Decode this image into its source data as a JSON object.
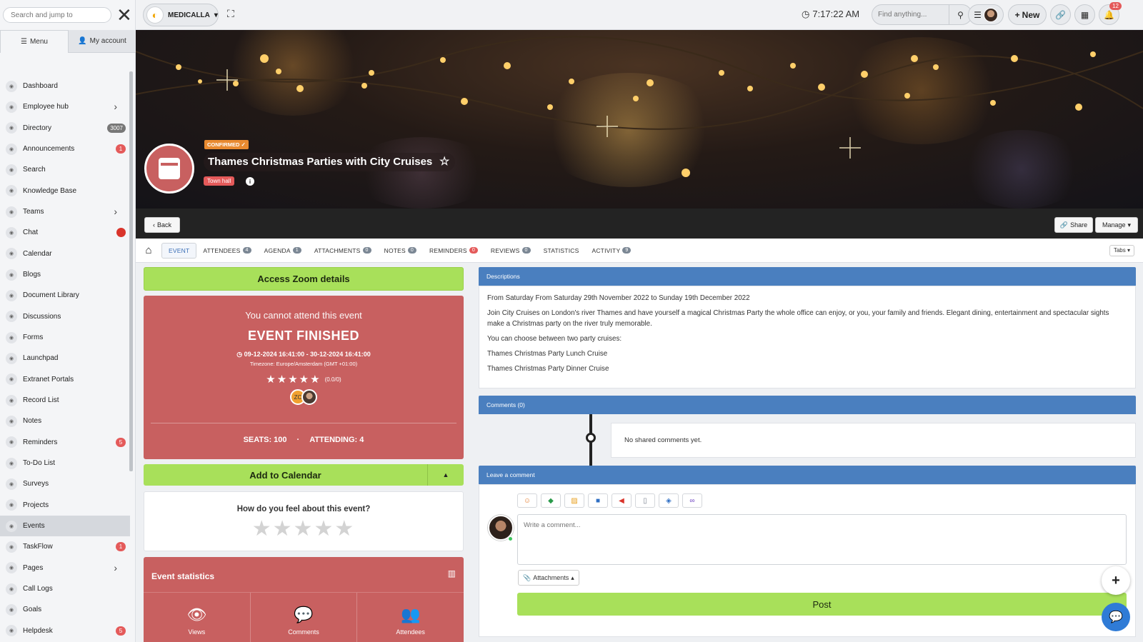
{
  "sidebar": {
    "search_placeholder": "Search and jump to",
    "tabs": [
      {
        "label": "Menu"
      },
      {
        "label": "My account"
      }
    ],
    "items": [
      {
        "label": "Dashboard"
      },
      {
        "label": "Employee hub"
      },
      {
        "label": "Directory",
        "badge": "3007"
      },
      {
        "label": "Announcements",
        "badge": "1"
      },
      {
        "label": "Search"
      },
      {
        "label": "Knowledge Base"
      },
      {
        "label": "Teams"
      },
      {
        "label": "Chat"
      },
      {
        "label": "Calendar"
      },
      {
        "label": "Blogs"
      },
      {
        "label": "Document Library"
      },
      {
        "label": "Discussions"
      },
      {
        "label": "Forms"
      },
      {
        "label": "Launchpad"
      },
      {
        "label": "Extranet Portals"
      },
      {
        "label": "Record List"
      },
      {
        "label": "Notes"
      },
      {
        "label": "Reminders",
        "badge": "5"
      },
      {
        "label": "To-Do List"
      },
      {
        "label": "Surveys"
      },
      {
        "label": "Projects"
      },
      {
        "label": "Events"
      },
      {
        "label": "TaskFlow",
        "badge": "1"
      },
      {
        "label": "Pages"
      },
      {
        "label": "Call Logs"
      },
      {
        "label": "Goals"
      },
      {
        "label": "Helpdesk",
        "badge": "5"
      }
    ]
  },
  "topbar": {
    "brand": "MEDICALLA",
    "time": "7:17:22 AM",
    "find_placeholder": "Find anything...",
    "new_label": "New",
    "notifications": "12"
  },
  "event": {
    "status": "CONFIRMED",
    "title": "Thames Christmas Parties with City Cruises",
    "category": "Town hall",
    "back_label": "Back",
    "share_label": "Share",
    "manage_label": "Manage"
  },
  "tabs": {
    "items": [
      {
        "label": "Event"
      },
      {
        "label": "Attendees",
        "count": "4"
      },
      {
        "label": "Agenda",
        "count": "1"
      },
      {
        "label": "Attachments",
        "count": "0"
      },
      {
        "label": "Notes",
        "count": "0"
      },
      {
        "label": "Reminders",
        "count": "0"
      },
      {
        "label": "Reviews",
        "count": "0"
      },
      {
        "label": "Statistics"
      },
      {
        "label": "Activity",
        "count": "9"
      }
    ],
    "tabs_button": "Tabs"
  },
  "left": {
    "zoom_label": "Access Zoom details",
    "cannot_attend": "You cannot attend this event",
    "finished_title": "EVENT FINISHED",
    "date_range": "09-12-2024 16:41:00 - 30-12-2024 16:41:00",
    "timezone": "Timezone: Europe/Amsterdam (GMT +01:00)",
    "rating_text": "(0.0/0)",
    "rating_value": 0,
    "attendee_initials": "ZC",
    "seats": "SEATS: 100",
    "attending": "ATTENDING: 4",
    "add_calendar": "Add to Calendar",
    "feel_question": "How do you feel about this event?",
    "stats_title": "Event statistics",
    "stats": [
      {
        "label": "Views"
      },
      {
        "label": "Comments"
      },
      {
        "label": "Attendees"
      }
    ]
  },
  "right": {
    "desc_header": "Descriptions",
    "desc_paragraphs": [
      "From Saturday From Saturday 29th November 2022 to Sunday 19th December 2022",
      "Join City Cruises on London's river Thames and have yourself a magical Christmas Party the whole office can enjoy, or you, your family and friends. Elegant dining, entertainment and spectacular sights make a Christmas party on the river truly memorable.",
      "You can choose between two party cruises:",
      "Thames Christmas Party Lunch Cruise",
      "Thames Christmas Party Dinner Cruise"
    ],
    "comments_header": "Comments (0)",
    "no_comments": "No shared comments yet.",
    "leave_header": "Leave a comment",
    "comment_placeholder": "Write a comment...",
    "attachments_label": "Attachments",
    "post_label": "Post"
  },
  "colors": {
    "accent_green": "#a8e05a",
    "event_red": "#c86060",
    "panel_blue": "#4a7fbf",
    "badge_red": "#e45a5a"
  }
}
